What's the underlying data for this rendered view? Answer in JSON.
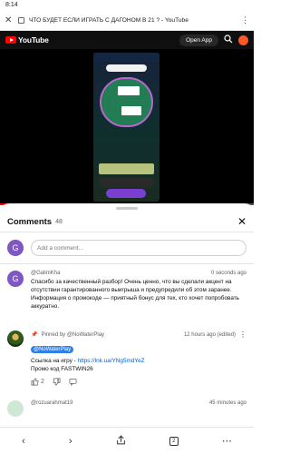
{
  "status_bar": {
    "time": "8:14"
  },
  "browser": {
    "tab_title": "ЧТО БУДЕТ ЕСЛИ ИГРАТЬ С ДАГОНОМ В 21 ? - YouTube"
  },
  "youtube": {
    "logo_text": "YouTube",
    "open_app_label": "Open App"
  },
  "video": {
    "progress_fraction": 0.04
  },
  "comments": {
    "title": "Comments",
    "count": "48",
    "add_placeholder": "Add a comment...",
    "user_avatar_letter": "G",
    "items": [
      {
        "avatar_letter": "G",
        "author": "@GalimKha",
        "time": "0 seconds ago",
        "text": "Спасибо за качественный разбор! Очень ценно, что вы сделали акцент на отсутствии гарантированного выигрыша и предупредили об этом заранее. Информация о промокоде — приятный бонус для тех, кто хочет попробовать аккуратно."
      },
      {
        "pinned_by": "Pinned by @NoWaterPlay",
        "author": "@NoWaterPlay",
        "time": "12 hours ago (edited)",
        "text_prefix": "Ссылка на игру - ",
        "link": "https://lnk.ua/YNg5mdYeZ",
        "text_line2": "Промо код FASTWIN26",
        "likes": "2"
      },
      {
        "author": "@rozuarahmat19",
        "time": "45 minutes ago"
      }
    ]
  },
  "nav": {
    "tabs_count": "2"
  }
}
